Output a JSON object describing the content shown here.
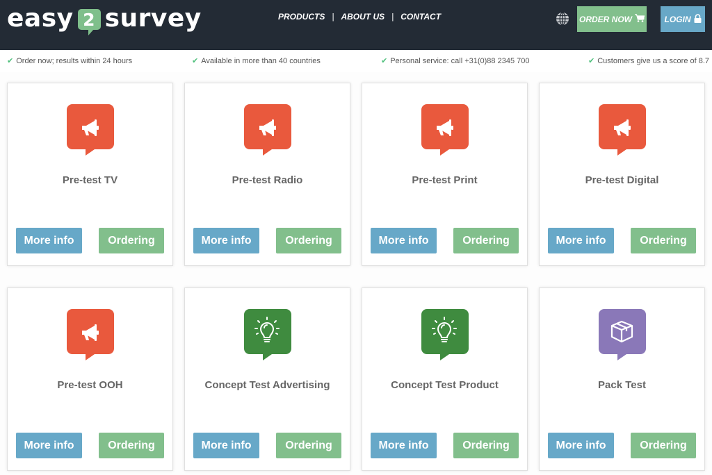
{
  "header": {
    "logo": {
      "left": "easy",
      "badge": "2",
      "right": "survey",
      "badge_color": "#7fbf8b"
    },
    "nav": [
      {
        "label": "PRODUCTS"
      },
      {
        "label": "ABOUT US"
      },
      {
        "label": "CONTACT"
      }
    ],
    "nav_separator": "|",
    "language_icon": "globe-icon",
    "order_now": {
      "label": "ORDER NOW",
      "icon": "cart-icon",
      "color": "#82bf8c"
    },
    "login": {
      "label": "LOGIN",
      "icon": "lock-icon",
      "color": "#68a8c7"
    }
  },
  "usp_bar": [
    {
      "text": "Order now; results within 24 hours"
    },
    {
      "text": "Available in more than 40 countries"
    },
    {
      "text": "Personal service: call +31(0)88 2345 700"
    },
    {
      "text": "Customers give us a score of 8.7"
    }
  ],
  "products": [
    {
      "title": "Pre-test TV",
      "icon": "megaphone-icon",
      "color": "#e9593d",
      "more_info": "More info",
      "ordering": "Ordering"
    },
    {
      "title": "Pre-test Radio",
      "icon": "megaphone-icon",
      "color": "#e9593d",
      "more_info": "More info",
      "ordering": "Ordering"
    },
    {
      "title": "Pre-test Print",
      "icon": "megaphone-icon",
      "color": "#e9593d",
      "more_info": "More info",
      "ordering": "Ordering"
    },
    {
      "title": "Pre-test Digital",
      "icon": "megaphone-icon",
      "color": "#e9593d",
      "more_info": "More info",
      "ordering": "Ordering"
    },
    {
      "title": "Pre-test OOH",
      "icon": "megaphone-icon",
      "color": "#e9593d",
      "more_info": "More info",
      "ordering": "Ordering"
    },
    {
      "title": "Concept Test Advertising",
      "icon": "lightbulb-icon",
      "color": "#3f8b3f",
      "more_info": "More info",
      "ordering": "Ordering"
    },
    {
      "title": "Concept Test Product",
      "icon": "lightbulb-icon",
      "color": "#3f8b3f",
      "more_info": "More info",
      "ordering": "Ordering"
    },
    {
      "title": "Pack Test",
      "icon": "box-icon",
      "color": "#8a78b8",
      "more_info": "More info",
      "ordering": "Ordering"
    }
  ]
}
